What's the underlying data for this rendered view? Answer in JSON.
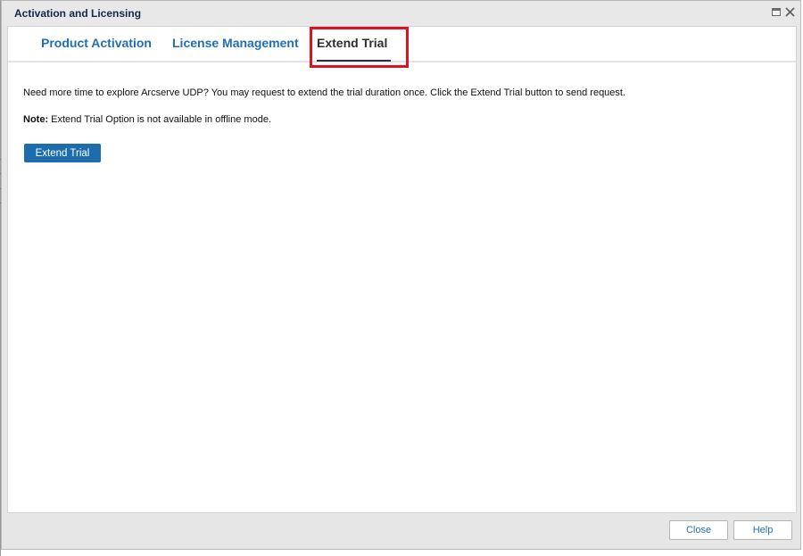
{
  "window": {
    "title": "Activation and Licensing"
  },
  "tabs": [
    {
      "label": "Product Activation",
      "active": false
    },
    {
      "label": "License Management",
      "active": false
    },
    {
      "label": "Extend Trial",
      "active": true
    }
  ],
  "extend_trial": {
    "description": "Need more time to explore Arcserve UDP? You may request to extend the trial duration once. Click the Extend Trial button to send request.",
    "note_label": "Note:",
    "note_text": " Extend Trial Option is not available in offline mode.",
    "button_label": "Extend Trial"
  },
  "footer": {
    "close_label": "Close",
    "help_label": "Help"
  },
  "colors": {
    "tab_link": "#1f6fb5",
    "button_primary": "#1b6dae",
    "highlight": "#e0121f",
    "title_text": "#15284b"
  },
  "icons": [
    "restore-icon",
    "close-icon"
  ]
}
